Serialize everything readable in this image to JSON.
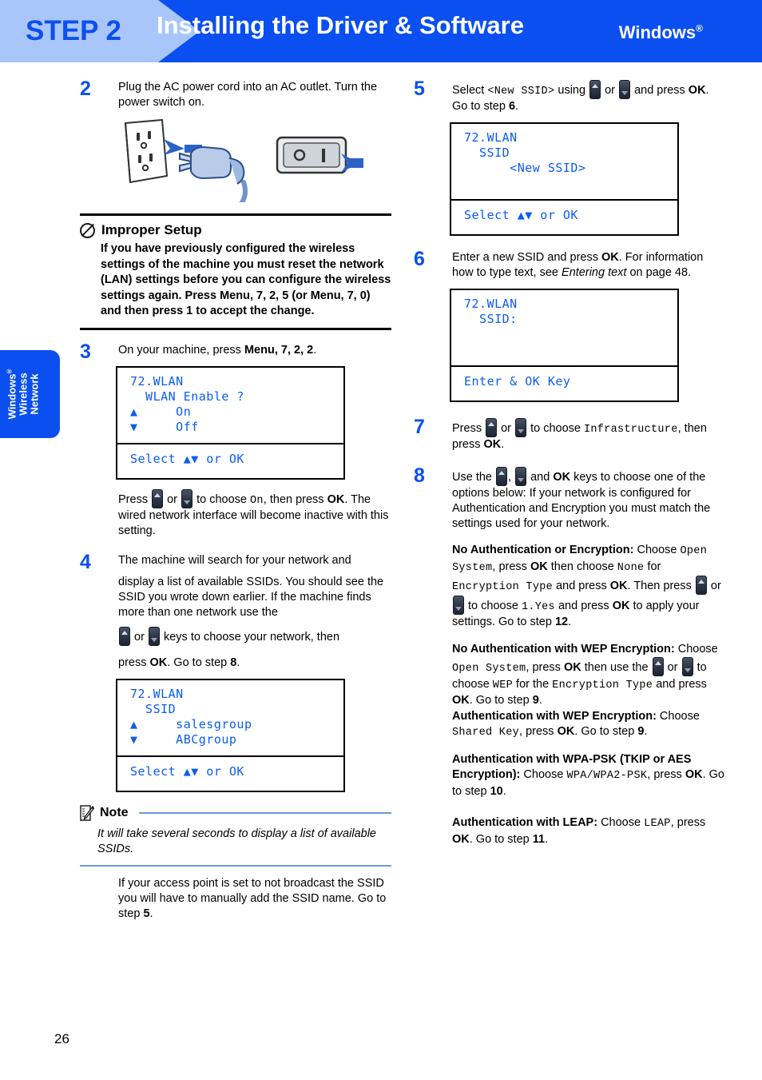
{
  "header": {
    "step_label": "STEP 2",
    "title": "Installing the Driver & Software",
    "os": "Windows",
    "os_sup": "®",
    "bg_color": "#0b4ff0",
    "chevron_color": "#a9c6fb"
  },
  "side_tab": {
    "line1": "Windows",
    "line1_sup": "®",
    "line2": "Wireless",
    "line3": "Network"
  },
  "page_number": "26",
  "left": {
    "step2": {
      "num": "2",
      "text": "Plug the AC power cord into an AC outlet. Turn the power switch on.",
      "illustration": "ac-outlet-and-power-switch"
    },
    "improper": {
      "icon": "no-entry-icon",
      "title": "Improper Setup",
      "body": "If you have previously configured the wireless settings of the machine you must reset the network (LAN) settings before you can configure the wireless settings again. Press Menu, 7, 2, 5 (or Menu, 7, 0) and then press 1 to accept the change."
    },
    "step3": {
      "num": "3",
      "text_pre": "On your machine, press ",
      "keys": "Menu, 7, 2, 2",
      "text_post": ".",
      "lcd": {
        "line1": "72.WLAN",
        "line2": "  WLAN Enable ?",
        "line3_arrow": "▲",
        "line3": "     On",
        "line4_arrow": "▼",
        "line4": "     Off",
        "footer_pre": "Select ",
        "footer_arrows": "▲▼",
        "footer_post": " or OK"
      },
      "after_pre": "Press ",
      "after_mid1": " or ",
      "after_mid2": " to choose ",
      "after_mono": "On",
      "after_mid3": ", then press ",
      "after_ok": "OK",
      "after_post": ". The wired network interface will become inactive with this setting."
    },
    "step4": {
      "num": "4",
      "para1": "The machine will search for your network and",
      "para2": "display a list of available SSIDs. You should see the SSID you wrote down earlier. If the machine finds more than one network use the",
      "para3_pre": " or ",
      "para3_post": " keys to choose your network, then",
      "para4_pre": "press ",
      "para4_ok": "OK",
      "para4_mid": ". Go to step ",
      "para4_step": "8",
      "para4_post": ".",
      "lcd": {
        "line1": "72.WLAN",
        "line2": "  SSID",
        "line3_arrow": "▲",
        "line3": "     salesgroup",
        "line4_arrow": "▼",
        "line4": "     ABCgroup",
        "footer_pre": "Select ",
        "footer_arrows": "▲▼",
        "footer_post": " or OK"
      }
    },
    "note": {
      "icon": "note-pencil-icon",
      "title": "Note",
      "body": "It will take several seconds to display a list of available SSIDs."
    },
    "after_note": {
      "pre": "If your access point is set to not broadcast the SSID you will have to manually add the SSID name. Go to step ",
      "step": "5",
      "post": "."
    }
  },
  "right": {
    "step5": {
      "num": "5",
      "pre": "Select ",
      "mono": "<New SSID>",
      "mid1": " using ",
      "mid2": " or ",
      "mid3": " and press ",
      "ok": "OK",
      "mid4": ". Go to step ",
      "step": "6",
      "post": ".",
      "lcd": {
        "line1": "72.WLAN",
        "line2": "  SSID",
        "line3": "      <New SSID>",
        "line4": "",
        "footer_pre": "Select ",
        "footer_arrows": "▲▼",
        "footer_post": " or OK"
      }
    },
    "step6": {
      "num": "6",
      "pre": "Enter a new SSID and press ",
      "ok": "OK",
      "mid": ". For information how to type text, see ",
      "ital": "Entering text",
      "post": " on page 48.",
      "lcd": {
        "line1": "72.WLAN",
        "line2": "  SSID:",
        "line3": "",
        "line4": "",
        "footer": "Enter & OK Key"
      }
    },
    "step7": {
      "num": "7",
      "pre": "Press ",
      "mid1": " or ",
      "mid2": " to choose ",
      "mono": "Infrastructure",
      "mid3": ", then press ",
      "ok": "OK",
      "post": "."
    },
    "step8": {
      "num": "8",
      "pre": "Use the ",
      "mid1": ", ",
      "mid2": " and ",
      "ok": "OK",
      "post": " keys to choose one of the options below: If your network is configured for Authentication and Encryption you must match the settings used for your network."
    },
    "options": {
      "opt1": {
        "title": "No Authentication or Encryption:",
        "t1": " Choose ",
        "m1": "Open System",
        "t2": ", press ",
        "b1": "OK",
        "t3": " then choose ",
        "m2": "None",
        "t4": " for ",
        "m3": "Encryption Type",
        "t5": " and press ",
        "b2": "OK",
        "t6": ". Then press ",
        "t7": " or ",
        "t8": " to choose ",
        "m4": "1.Yes",
        "t9": " and press ",
        "b3": "OK",
        "t10": " to apply your settings. Go to step ",
        "b4": "12",
        "t11": "."
      },
      "opt2": {
        "title": "No Authentication with WEP Encryption:",
        "t1": " Choose ",
        "m1": "Open System",
        "t2": ", press ",
        "b1": "OK",
        "t3": " then use the ",
        "t4": " or ",
        "t5": " to choose ",
        "m2": "WEP",
        "t6": " for the ",
        "m3": "Encryption Type",
        "t7": " and press ",
        "b2": "OK",
        "t8": ". Go to step ",
        "b3": "9",
        "t9": ".",
        "title2": "Authentication with WEP Encryption:",
        "u1": " Choose ",
        "m4": "Shared Key",
        "u2": ", press ",
        "b4": "OK",
        "u3": ". Go to step ",
        "b5": "9",
        "u4": "."
      },
      "opt3": {
        "title": "Authentication with WPA-PSK (TKIP or AES Encryption):",
        "t1": " Choose ",
        "m1": "WPA/WPA2-PSK",
        "t2": ", press ",
        "b1": "OK",
        "t3": ". Go to step ",
        "b2": "10",
        "t4": "."
      },
      "opt4": {
        "title": "Authentication with LEAP:",
        "t1": " Choose ",
        "m1": "LEAP",
        "t2": ", press ",
        "b1": "OK",
        "t3": ". Go to step ",
        "b2": "11",
        "t4": "."
      }
    }
  }
}
